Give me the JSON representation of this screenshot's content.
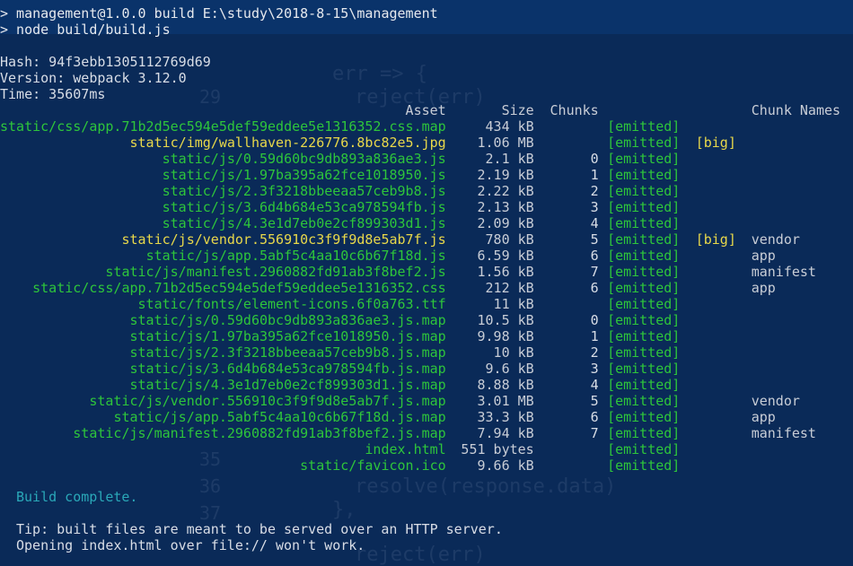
{
  "terminal": {
    "command_line_1": "> management@1.0.0 build E:\\study\\2018-8-15\\management",
    "command_line_2": "> node build/build.js",
    "hash": "Hash: 94f3ebb1305112769d69",
    "version": "Version: webpack 3.12.0",
    "time": "Time: 35607ms",
    "headers": {
      "asset": "Asset",
      "size": "Size",
      "chunks": "Chunks",
      "chunk_names": "Chunk Names"
    },
    "assets": [
      {
        "asset": "static/css/app.71b2d5ec594e5def59eddee5e1316352.css.map",
        "size": "434 kB",
        "chunk": "",
        "emitted": "[emitted]",
        "big": "",
        "name": "",
        "color": "green"
      },
      {
        "asset": "static/img/wallhaven-226776.8bc82e5.jpg",
        "size": "1.06 MB",
        "chunk": "",
        "emitted": "[emitted]",
        "big": "[big]",
        "name": "",
        "color": "yellow"
      },
      {
        "asset": "static/js/0.59d60bc9db893a836ae3.js",
        "size": "2.1 kB",
        "chunk": "0",
        "emitted": "[emitted]",
        "big": "",
        "name": "",
        "color": "green"
      },
      {
        "asset": "static/js/1.97ba395a62fce1018950.js",
        "size": "2.19 kB",
        "chunk": "1",
        "emitted": "[emitted]",
        "big": "",
        "name": "",
        "color": "green"
      },
      {
        "asset": "static/js/2.3f3218bbeeaa57ceb9b8.js",
        "size": "2.22 kB",
        "chunk": "2",
        "emitted": "[emitted]",
        "big": "",
        "name": "",
        "color": "green"
      },
      {
        "asset": "static/js/3.6d4b684e53ca978594fb.js",
        "size": "2.13 kB",
        "chunk": "3",
        "emitted": "[emitted]",
        "big": "",
        "name": "",
        "color": "green"
      },
      {
        "asset": "static/js/4.3e1d7eb0e2cf899303d1.js",
        "size": "2.09 kB",
        "chunk": "4",
        "emitted": "[emitted]",
        "big": "",
        "name": "",
        "color": "green"
      },
      {
        "asset": "static/js/vendor.556910c3f9f9d8e5ab7f.js",
        "size": "780 kB",
        "chunk": "5",
        "emitted": "[emitted]",
        "big": "[big]",
        "name": "vendor",
        "color": "yellow"
      },
      {
        "asset": "static/js/app.5abf5c4aa10c6b67f18d.js",
        "size": "6.59 kB",
        "chunk": "6",
        "emitted": "[emitted]",
        "big": "",
        "name": "app",
        "color": "green"
      },
      {
        "asset": "static/js/manifest.2960882fd91ab3f8bef2.js",
        "size": "1.56 kB",
        "chunk": "7",
        "emitted": "[emitted]",
        "big": "",
        "name": "manifest",
        "color": "green"
      },
      {
        "asset": "static/css/app.71b2d5ec594e5def59eddee5e1316352.css",
        "size": "212 kB",
        "chunk": "6",
        "emitted": "[emitted]",
        "big": "",
        "name": "app",
        "color": "green"
      },
      {
        "asset": "static/fonts/element-icons.6f0a763.ttf",
        "size": "11 kB",
        "chunk": "",
        "emitted": "[emitted]",
        "big": "",
        "name": "",
        "color": "green"
      },
      {
        "asset": "static/js/0.59d60bc9db893a836ae3.js.map",
        "size": "10.5 kB",
        "chunk": "0",
        "emitted": "[emitted]",
        "big": "",
        "name": "",
        "color": "green"
      },
      {
        "asset": "static/js/1.97ba395a62fce1018950.js.map",
        "size": "9.98 kB",
        "chunk": "1",
        "emitted": "[emitted]",
        "big": "",
        "name": "",
        "color": "green"
      },
      {
        "asset": "static/js/2.3f3218bbeeaa57ceb9b8.js.map",
        "size": "10 kB",
        "chunk": "2",
        "emitted": "[emitted]",
        "big": "",
        "name": "",
        "color": "green"
      },
      {
        "asset": "static/js/3.6d4b684e53ca978594fb.js.map",
        "size": "9.6 kB",
        "chunk": "3",
        "emitted": "[emitted]",
        "big": "",
        "name": "",
        "color": "green"
      },
      {
        "asset": "static/js/4.3e1d7eb0e2cf899303d1.js.map",
        "size": "8.88 kB",
        "chunk": "4",
        "emitted": "[emitted]",
        "big": "",
        "name": "",
        "color": "green"
      },
      {
        "asset": "static/js/vendor.556910c3f9f9d8e5ab7f.js.map",
        "size": "3.01 MB",
        "chunk": "5",
        "emitted": "[emitted]",
        "big": "",
        "name": "vendor",
        "color": "green"
      },
      {
        "asset": "static/js/app.5abf5c4aa10c6b67f18d.js.map",
        "size": "33.3 kB",
        "chunk": "6",
        "emitted": "[emitted]",
        "big": "",
        "name": "app",
        "color": "green"
      },
      {
        "asset": "static/js/manifest.2960882fd91ab3f8bef2.js.map",
        "size": "7.94 kB",
        "chunk": "7",
        "emitted": "[emitted]",
        "big": "",
        "name": "manifest",
        "color": "green"
      },
      {
        "asset": "index.html",
        "size": "551 bytes",
        "chunk": "",
        "emitted": "[emitted]",
        "big": "",
        "name": "",
        "color": "green"
      },
      {
        "asset": "static/favicon.ico",
        "size": "9.66 kB",
        "chunk": "",
        "emitted": "[emitted]",
        "big": "",
        "name": "",
        "color": "green"
      }
    ],
    "build_complete": "Build complete.",
    "tip_line_1": "Tip: built files are meant to be served over an HTTP server.",
    "tip_line_2": "Opening index.html over file:// won't work."
  },
  "colors": {
    "background": "#0a2a58",
    "emitted_green": "#2ec53b",
    "big_yellow": "#e8d84a",
    "build_cyan": "#2aa8b8"
  }
}
